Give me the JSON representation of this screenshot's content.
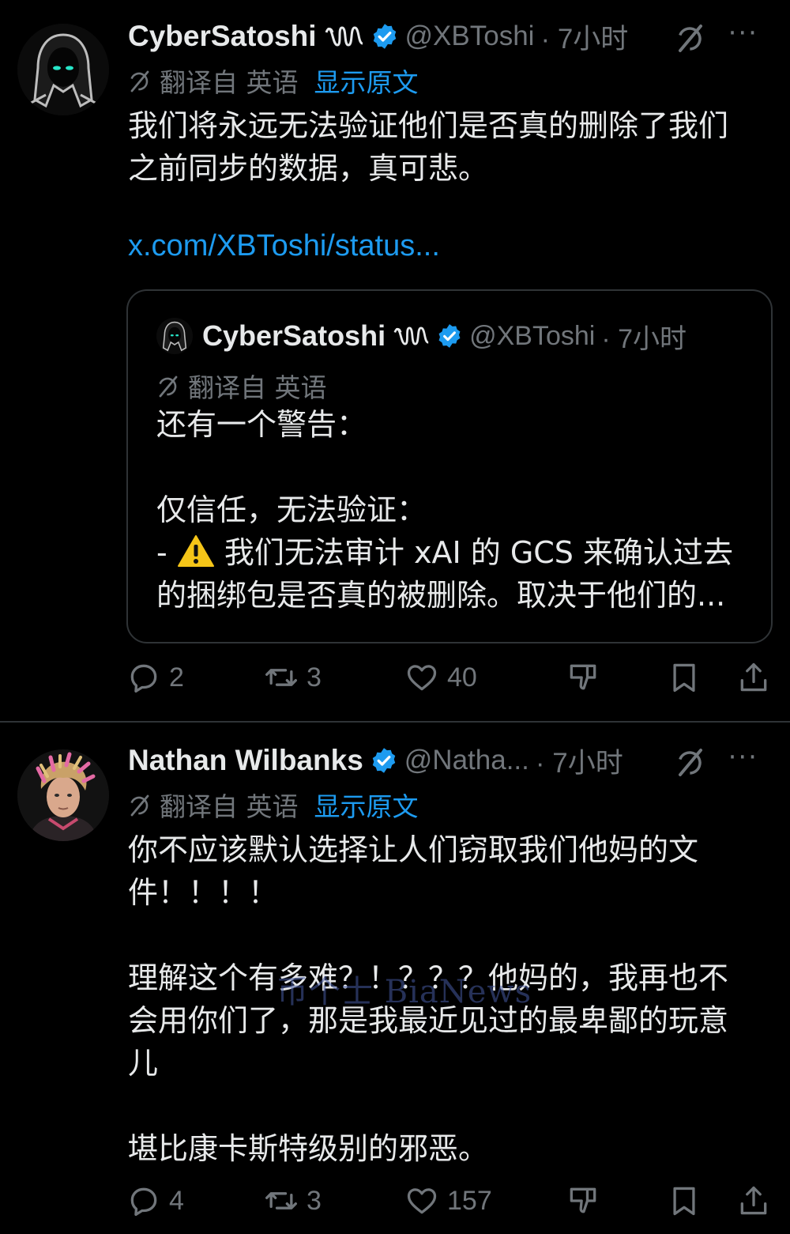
{
  "tweets": [
    {
      "name": "CyberSatoshi",
      "handle": "@XBToshi",
      "time": "· 7小时",
      "translated_from": "翻译自 英语",
      "show_original": "显示原文",
      "text": "我们将永远无法验证他们是否真的删除了我们\n之前同步的数据，真可悲。",
      "link": "x.com/XBToshi/status...",
      "quote": {
        "name": "CyberSatoshi",
        "handle": "@XBToshi",
        "time": "· 7小时",
        "translated_from": "翻译自 英语",
        "text_top": "还有一个警告：\n\n仅信任，无法验证：\n- ",
        "text_warn": "我们无法审计 xAI 的 GCS 来确认过去\n的捆绑包是否真的被删除。取决于他们的..."
      },
      "stats": {
        "replies": "2",
        "reposts": "3",
        "likes": "40"
      }
    },
    {
      "name": "Nathan Wilbanks",
      "handle": "@Natha...",
      "time": "· 7小时",
      "translated_from": "翻译自 英语",
      "show_original": "显示原文",
      "text": "你不应该默认选择让人们窃取我们他妈的文\n件！！！！\n\n理解这个有多难？！？？？他妈的，我再也不\n会用你们了，那是我最近见过的最卑鄙的玩意\n儿\n\n堪比康卡斯特级别的邪恶。",
      "stats": {
        "replies": "4",
        "reposts": "3",
        "likes": "157"
      }
    }
  ],
  "watermark": "币个士 BiaNews",
  "colors": {
    "background": "#000000",
    "text": "#e7e9ea",
    "muted": "#71767b",
    "accent": "#1d9bf0",
    "border": "#2f3336"
  },
  "icons": [
    "grok-icon",
    "more-icon",
    "verified-badge-icon",
    "translate-icon",
    "reply-icon",
    "repost-icon",
    "like-icon",
    "dislike-icon",
    "bookmark-icon",
    "share-icon",
    "warning-icon"
  ]
}
